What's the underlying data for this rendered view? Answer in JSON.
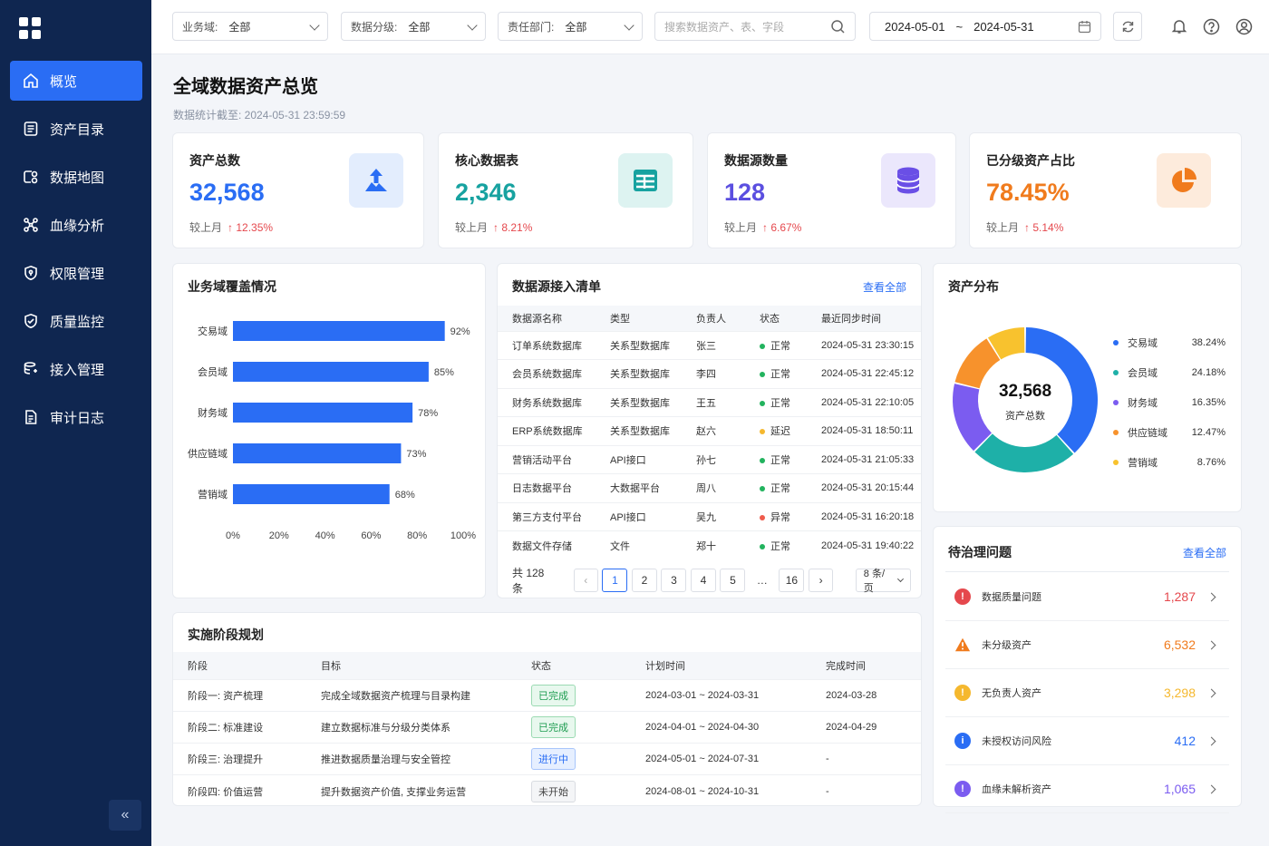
{
  "sidebar": {
    "items": [
      {
        "label": "概览",
        "icon": "home-icon"
      },
      {
        "label": "资产目录",
        "icon": "list-icon"
      },
      {
        "label": "数据地图",
        "icon": "map-icon"
      },
      {
        "label": "血缘分析",
        "icon": "lineage-icon"
      },
      {
        "label": "权限管理",
        "icon": "shield-icon"
      },
      {
        "label": "质量监控",
        "icon": "shield-check-icon"
      },
      {
        "label": "接入管理",
        "icon": "database-link-icon"
      },
      {
        "label": "审计日志",
        "icon": "log-icon"
      }
    ],
    "collapse_glyph": "«",
    "accent": "#2a6df4",
    "background": "#0f2650"
  },
  "filters": {
    "domain": {
      "label": "业务域:",
      "value": "全部"
    },
    "level": {
      "label": "数据分级:",
      "value": "全部"
    },
    "dept": {
      "label": "责任部门:",
      "value": "全部"
    },
    "search_placeholder": "搜索数据资产、表、字段",
    "date_start": "2024-05-01",
    "date_sep": "~",
    "date_end": "2024-05-31"
  },
  "header": {
    "title": "全域数据资产总览",
    "subtitle": "数据统计截至: 2024-05-31 23:59:59"
  },
  "kpis": [
    {
      "title": "资产总数",
      "value": "32,568",
      "compare": "较上月",
      "change": "↑ 12.35%",
      "color": "#2a6df4",
      "icon": "upload-icon"
    },
    {
      "title": "核心数据表",
      "value": "2,346",
      "compare": "较上月",
      "change": "↑ 8.21%",
      "color": "#17a2a0",
      "icon": "table-icon"
    },
    {
      "title": "数据源数量",
      "value": "128",
      "compare": "较上月",
      "change": "↑ 6.67%",
      "color": "#5b4fe0",
      "icon": "database-icon"
    },
    {
      "title": "已分级资产占比",
      "value": "78.45%",
      "compare": "较上月",
      "change": "↑ 5.14%",
      "color": "#f07b1d",
      "icon": "pie-icon"
    }
  ],
  "coverage": {
    "title": "业务域覆盖情况"
  },
  "chart_data": {
    "type": "bar",
    "orientation": "horizontal",
    "categories": [
      "交易域",
      "会员域",
      "财务域",
      "供应链域",
      "营销域"
    ],
    "values": [
      92,
      85,
      78,
      73,
      68
    ],
    "value_labels": [
      "92%",
      "85%",
      "78%",
      "73%",
      "68%"
    ],
    "xticks": [
      "0%",
      "20%",
      "40%",
      "60%",
      "80%",
      "100%"
    ],
    "xlim": [
      0,
      100
    ],
    "color": "#2a6df4"
  },
  "sources": {
    "title": "数据源接入清单",
    "view_all": "查看全部",
    "columns": [
      "数据源名称",
      "类型",
      "负责人",
      "状态",
      "最近同步时间"
    ],
    "rows": [
      {
        "name": "订单系统数据库",
        "type": "关系型数据库",
        "owner": "张三",
        "status": "正常",
        "status_color": "#22b35e",
        "time": "2024-05-31 23:30:15"
      },
      {
        "name": "会员系统数据库",
        "type": "关系型数据库",
        "owner": "李四",
        "status": "正常",
        "status_color": "#22b35e",
        "time": "2024-05-31 22:45:12"
      },
      {
        "name": "财务系统数据库",
        "type": "关系型数据库",
        "owner": "王五",
        "status": "正常",
        "status_color": "#22b35e",
        "time": "2024-05-31 22:10:05"
      },
      {
        "name": "ERP系统数据库",
        "type": "关系型数据库",
        "owner": "赵六",
        "status": "延迟",
        "status_color": "#f5b82e",
        "time": "2024-05-31 18:50:11"
      },
      {
        "name": "营销活动平台",
        "type": "API接口",
        "owner": "孙七",
        "status": "正常",
        "status_color": "#22b35e",
        "time": "2024-05-31 21:05:33"
      },
      {
        "name": "日志数据平台",
        "type": "大数据平台",
        "owner": "周八",
        "status": "正常",
        "status_color": "#22b35e",
        "time": "2024-05-31 20:15:44"
      },
      {
        "name": "第三方支付平台",
        "type": "API接口",
        "owner": "吴九",
        "status": "异常",
        "status_color": "#ef5b4c",
        "time": "2024-05-31 16:20:18"
      },
      {
        "name": "数据文件存储",
        "type": "文件",
        "owner": "郑十",
        "status": "正常",
        "status_color": "#22b35e",
        "time": "2024-05-31 19:40:22"
      }
    ],
    "pager": {
      "total": "共 128 条",
      "prev": "‹",
      "pages": [
        "1",
        "2",
        "3",
        "4",
        "5",
        "…",
        "16"
      ],
      "current": "1",
      "next": "›",
      "page_size": "8 条/页"
    }
  },
  "distribution": {
    "title": "资产分布",
    "center_value": "32,568",
    "center_label": "资产总数",
    "slices": [
      {
        "label": "交易域",
        "percent": "38.24%",
        "value": 38.24,
        "color": "#2a6df4"
      },
      {
        "label": "会员域",
        "percent": "24.18%",
        "value": 24.18,
        "color": "#1eb0a8"
      },
      {
        "label": "财务域",
        "percent": "16.35%",
        "value": 16.35,
        "color": "#7b5cf0"
      },
      {
        "label": "供应链域",
        "percent": "12.47%",
        "value": 12.47,
        "color": "#f7922c"
      },
      {
        "label": "营销域",
        "percent": "8.76%",
        "value": 8.76,
        "color": "#f8c22e"
      }
    ]
  },
  "phases": {
    "title": "实施阶段规划",
    "columns": [
      "阶段",
      "目标",
      "状态",
      "计划时间",
      "完成时间"
    ],
    "rows": [
      {
        "phase": "阶段一: 资产梳理",
        "goal": "完成全域数据资产梳理与目录构建",
        "status": "已完成",
        "tag": "done",
        "plan": "2024-03-01 ~ 2024-03-31",
        "done": "2024-03-28"
      },
      {
        "phase": "阶段二: 标准建设",
        "goal": "建立数据标准与分级分类体系",
        "status": "已完成",
        "tag": "done",
        "plan": "2024-04-01 ~ 2024-04-30",
        "done": "2024-04-29"
      },
      {
        "phase": "阶段三: 治理提升",
        "goal": "推进数据质量治理与安全管控",
        "status": "进行中",
        "tag": "doing",
        "plan": "2024-05-01 ~ 2024-07-31",
        "done": "-"
      },
      {
        "phase": "阶段四: 价值运营",
        "goal": "提升数据资产价值, 支撑业务运营",
        "status": "未开始",
        "tag": "todo",
        "plan": "2024-08-01 ~ 2024-10-31",
        "done": "-"
      }
    ]
  },
  "issues": {
    "title": "待治理问题",
    "view_all": "查看全部",
    "items": [
      {
        "label": "数据质量问题",
        "value": "1,287",
        "color": "#e5484d",
        "icon": "alert-circle-icon",
        "glyph": "!"
      },
      {
        "label": "未分级资产",
        "value": "6,532",
        "color": "#f07b1d",
        "icon": "warning-triangle-icon",
        "glyph": "!"
      },
      {
        "label": "无负责人资产",
        "value": "3,298",
        "color": "#f5b82e",
        "icon": "info-circle-icon",
        "glyph": "!"
      },
      {
        "label": "未授权访问风险",
        "value": "412",
        "color": "#2a6df4",
        "icon": "info-icon",
        "glyph": "i"
      },
      {
        "label": "血缘未解析资产",
        "value": "1,065",
        "color": "#7b5cf0",
        "icon": "lineage-alert-icon",
        "glyph": "!"
      }
    ]
  }
}
